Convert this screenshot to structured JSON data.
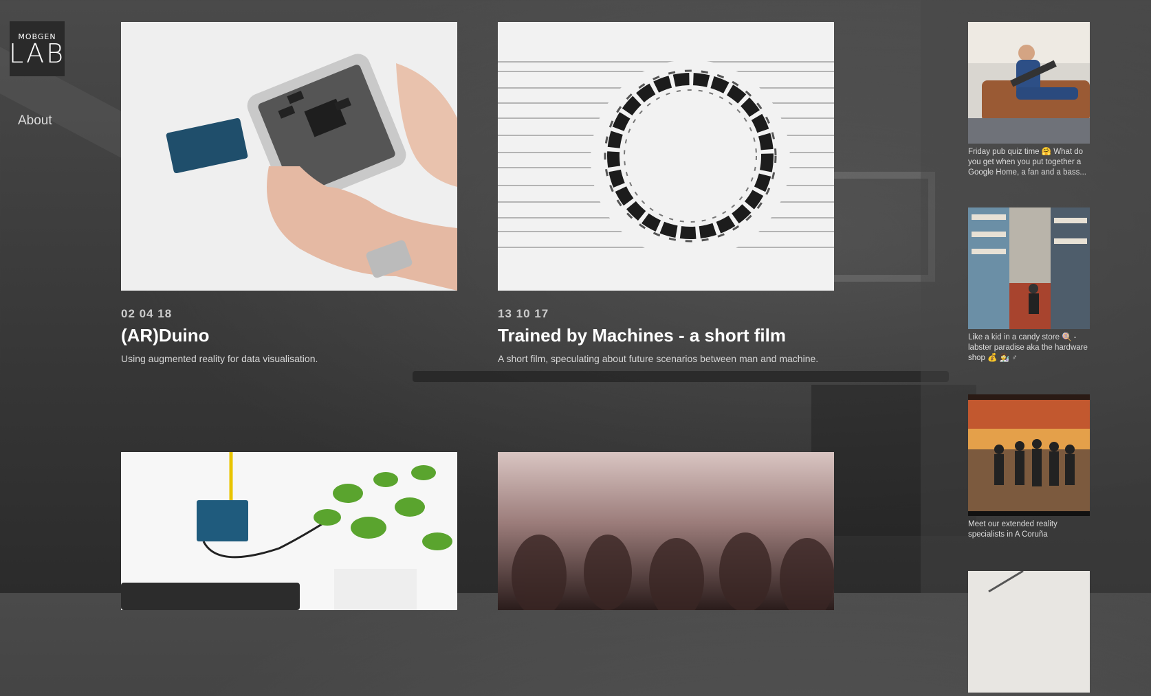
{
  "brand": {
    "logo_top": "MOBGEN",
    "logo_bottom": "LAB"
  },
  "nav": {
    "about": "About"
  },
  "articles": [
    {
      "date": "02 04 18",
      "title": "(AR)Duino",
      "description": "Using augmented reality for data visualisation."
    },
    {
      "date": "13 10 17",
      "title": "Trained by Machines - a short film",
      "description": "A short film, speculating about future scenarios between man and machine."
    },
    {
      "date": "",
      "title": "",
      "description": ""
    },
    {
      "date": "",
      "title": "",
      "description": ""
    }
  ],
  "instagram": [
    {
      "caption": "Friday pub quiz time 🤗  What do you get when you put together a Google Home, a fan and a bass..."
    },
    {
      "caption": "Like a kid in a candy store 🍭 - labster paradise aka the hardware shop 💰 👩‍🔬 ♂"
    },
    {
      "caption": "Meet our extended reality specialists in A Coruña"
    },
    {
      "caption": ""
    }
  ],
  "colors": {
    "background": "#3d3d3d",
    "sidebar": "#464646",
    "text": "#ffffff",
    "muted": "#cccccc"
  }
}
